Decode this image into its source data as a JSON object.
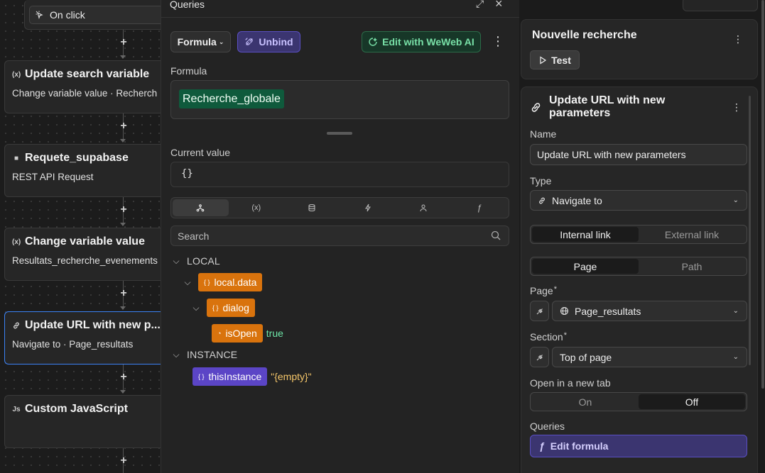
{
  "workflow": {
    "trigger_label": "On click",
    "cards": [
      {
        "icon": "(x)",
        "title": "Update search variable",
        "subtitle": "Change variable value · Recherch"
      },
      {
        "icon": "■",
        "title": "Requete_supabase",
        "subtitle": "REST API Request"
      },
      {
        "icon": "(x)",
        "title": "Change variable value",
        "subtitle": "Resultats_recherche_evenements"
      },
      {
        "icon": "🔗",
        "title": "Update URL with new p...",
        "subtitle": "Navigate to · Page_resultats",
        "selected": true
      },
      {
        "icon": "Js",
        "title": "Custom JavaScript",
        "subtitle": ""
      }
    ]
  },
  "queries_panel": {
    "title": "Queries",
    "formula_dropdown": "Formula",
    "unbind_label": "Unbind",
    "ai_label": "Edit with WeWeb AI",
    "formula_label": "Formula",
    "formula_value": "Recherche_globale",
    "current_value_label": "Current value",
    "current_value": "{}",
    "tab_icons": [
      "tree-icon",
      "variable-icon",
      "database-icon",
      "lightning-icon",
      "user-icon",
      "function-icon"
    ],
    "search_placeholder": "Search",
    "tree": {
      "local_label": "LOCAL",
      "local_data": "local.data",
      "dialog": "dialog",
      "is_open": "isOpen",
      "is_open_value": "true",
      "instance_label": "INSTANCE",
      "this_instance": "thisInstance",
      "this_instance_value": "\"{empty}\""
    }
  },
  "right_panel": {
    "workflow_title": "Nouvelle recherche",
    "test_label": "Test",
    "action_title": "Update URL with new parameters",
    "name_label": "Name",
    "name_value": "Update URL with new parameters",
    "type_label": "Type",
    "type_value": "Navigate to",
    "link_tabs": [
      "Internal link",
      "External link"
    ],
    "page_tabs": [
      "Page",
      "Path"
    ],
    "page_label": "Page",
    "page_value": "Page_resultats",
    "section_label": "Section",
    "section_value": "Top of page",
    "new_tab_label": "Open in a new tab",
    "new_tab_options": [
      "On",
      "Off"
    ],
    "queries_label": "Queries",
    "edit_formula_label": "Edit formula",
    "required_mark": "*"
  },
  "colors": {
    "accent_purple": "#5b45c6",
    "accent_green": "#0f5a3c",
    "chip_orange": "#d9730d",
    "selected_border": "#3b82f6"
  }
}
